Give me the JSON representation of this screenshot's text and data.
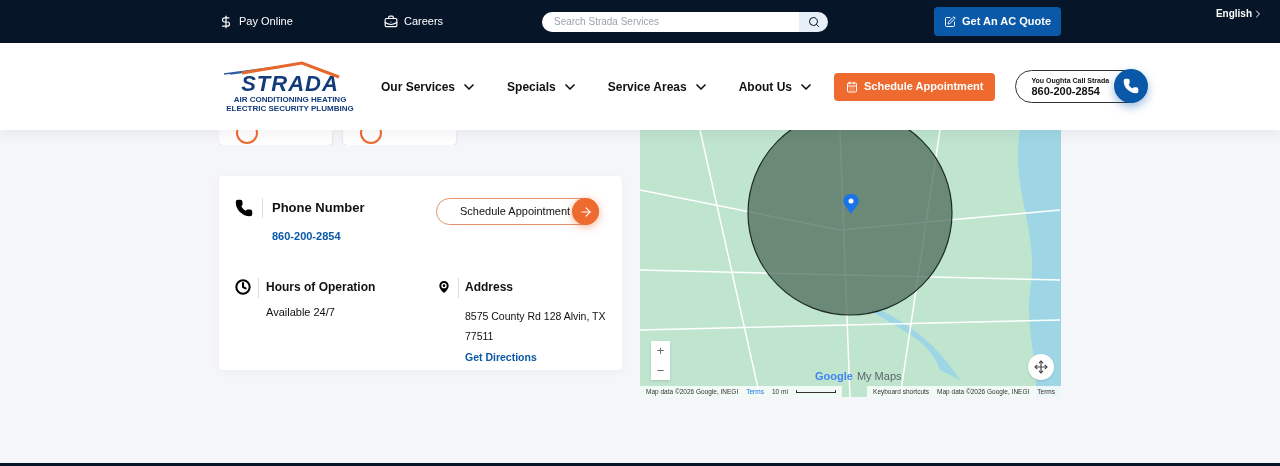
{
  "top_bar": {
    "links": [
      {
        "label": "Pay Online",
        "kind": "dollar"
      },
      {
        "label": "Careers",
        "kind": "briefcase"
      }
    ],
    "search": {
      "placeholder": "Search Strada Services"
    },
    "quote_button": {
      "label": "Get An AC Quote"
    },
    "language": {
      "label": "English"
    }
  },
  "header": {
    "logo": {
      "name": "STRADA",
      "line1": "AIR CONDITIONING HEATING",
      "line2": "ELECTRIC SECURITY PLUMBING"
    },
    "nav": [
      {
        "label": "Our Services"
      },
      {
        "label": "Specials"
      },
      {
        "label": "Service Areas"
      },
      {
        "label": "About Us"
      }
    ],
    "schedule_button": {
      "label": "Schedule Appointment"
    },
    "call": {
      "caption": "You Oughta Call Strada",
      "phone": "860-200-2854"
    }
  },
  "contact_card": {
    "phone": {
      "title": "Phone Number",
      "value": "860-200-2854"
    },
    "schedule_link": {
      "label": "Schedule Appointment"
    },
    "hours": {
      "title": "Hours of Operation",
      "value": "Available 24/7"
    },
    "address": {
      "title": "Address",
      "value": "8575 County Rd 128 Alvin, TX 77511",
      "link": "Get Directions"
    }
  },
  "map": {
    "zoom_in": "+",
    "zoom_out": "−",
    "logo_first": "Google",
    "logo_second": "My Maps",
    "attribution_left": "Map data ©2026 Google, INEGI",
    "terms_left": "Terms",
    "scale": "10 mi",
    "shortcuts": "Keyboard shortcuts",
    "attribution_right": "Map data ©2026 Google, INEGI",
    "terms_right": "Terms"
  }
}
